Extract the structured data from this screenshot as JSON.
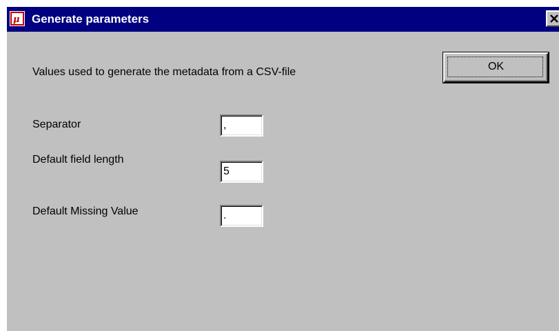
{
  "window": {
    "title": "Generate parameters",
    "icon": "mu-app-icon",
    "close_icon": "close-icon"
  },
  "dialog": {
    "description": "Values used to generate the metadata from a CSV-file",
    "ok_label": "OK",
    "fields": {
      "separator": {
        "label": "Separator",
        "value": ","
      },
      "field_length": {
        "label": "Default field length",
        "value": "5"
      },
      "missing_value": {
        "label": "Default Missing Value",
        "value": "."
      }
    }
  },
  "colors": {
    "titlebar": "#000080",
    "face": "#c0c0c0",
    "field_bg": "#ffffff",
    "icon_accent": "#c00000"
  }
}
